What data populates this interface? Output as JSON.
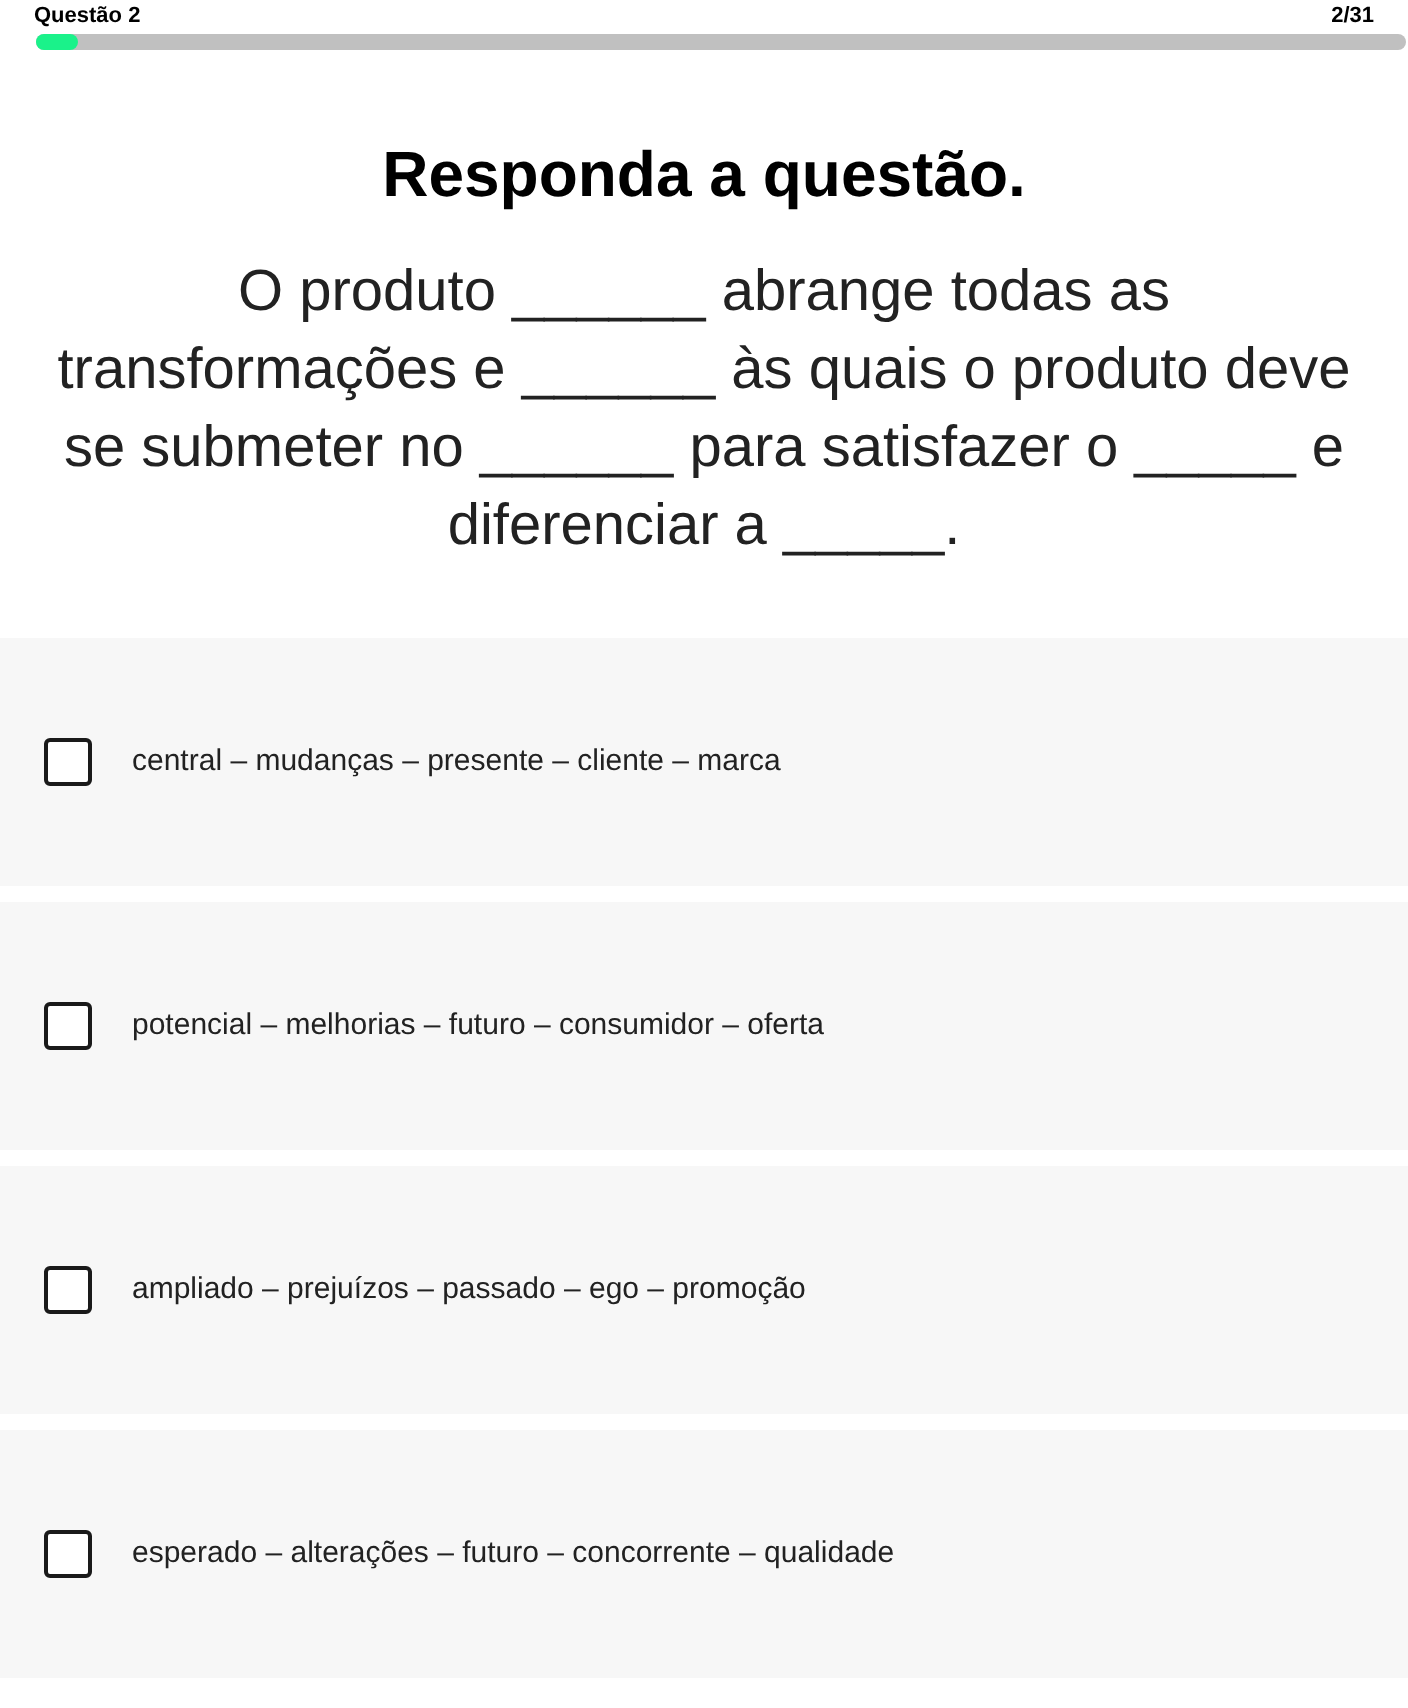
{
  "header": {
    "title": "Questão 2",
    "counter": "2/31",
    "progress": {
      "level": 0.03
    }
  },
  "heading": "Responda a questão.",
  "question": "O produto ______ abrange todas as transformações e ______ às quais o produto deve se submeter no ______ para satisfazer o _____ e diferenciar a _____.",
  "options": [
    {
      "text": "central – mudanças – presente – cliente – marca",
      "checked": false
    },
    {
      "text": "potencial – melhorias – futuro – consumidor – oferta",
      "checked": false
    },
    {
      "text": "ampliado – prejuízos – passado – ego – promoção",
      "checked": false
    },
    {
      "text": "esperado – alterações – futuro – concorrente – qualidade",
      "checked": false
    }
  ]
}
